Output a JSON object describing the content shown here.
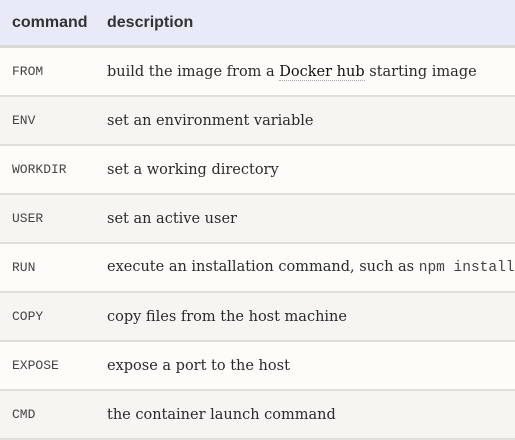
{
  "headers": {
    "command": "command",
    "description": "description"
  },
  "rows": [
    {
      "command": "FROM",
      "before": "build the image from a ",
      "link": "Docker hub",
      "after": " starting image"
    },
    {
      "command": "ENV",
      "description": "set an environment variable"
    },
    {
      "command": "WORKDIR",
      "description": "set a working directory"
    },
    {
      "command": "USER",
      "description": "set an active user"
    },
    {
      "command": "RUN",
      "description": "execute an installation command, such as ",
      "code": "npm install"
    },
    {
      "command": "COPY",
      "description": "copy files from the host machine"
    },
    {
      "command": "EXPOSE",
      "description": "expose a port to the host"
    },
    {
      "command": "CMD",
      "description": "the container launch command"
    }
  ]
}
